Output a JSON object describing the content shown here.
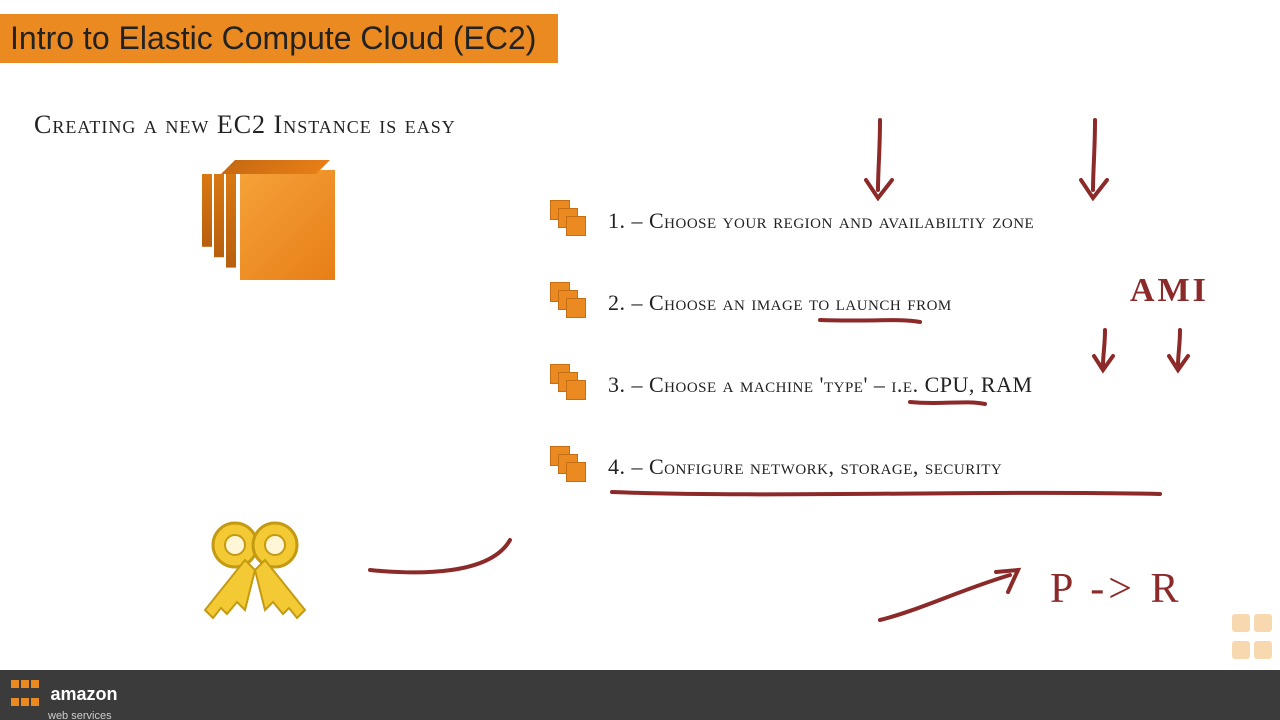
{
  "title": "Intro to Elastic Compute Cloud (EC2)",
  "subtitle": "Creating a new EC2 Instance is easy",
  "steps": [
    {
      "num": "1.",
      "text": "– Choose your region and availabiltiy zone"
    },
    {
      "num": "2.",
      "text": "– Choose an image to launch from"
    },
    {
      "num": "3.",
      "text": "– Choose a machine 'type' – i.e. CPU, RAM"
    },
    {
      "num": "4.",
      "text": "– Configure network, storage, security"
    }
  ],
  "annotations": {
    "ami": "AMI",
    "p_to_r": "P -> R"
  },
  "footer": {
    "brand": "amazon",
    "sub": "web services"
  },
  "colors": {
    "accent": "#ec8a22",
    "ink": "#8c2a2a"
  }
}
